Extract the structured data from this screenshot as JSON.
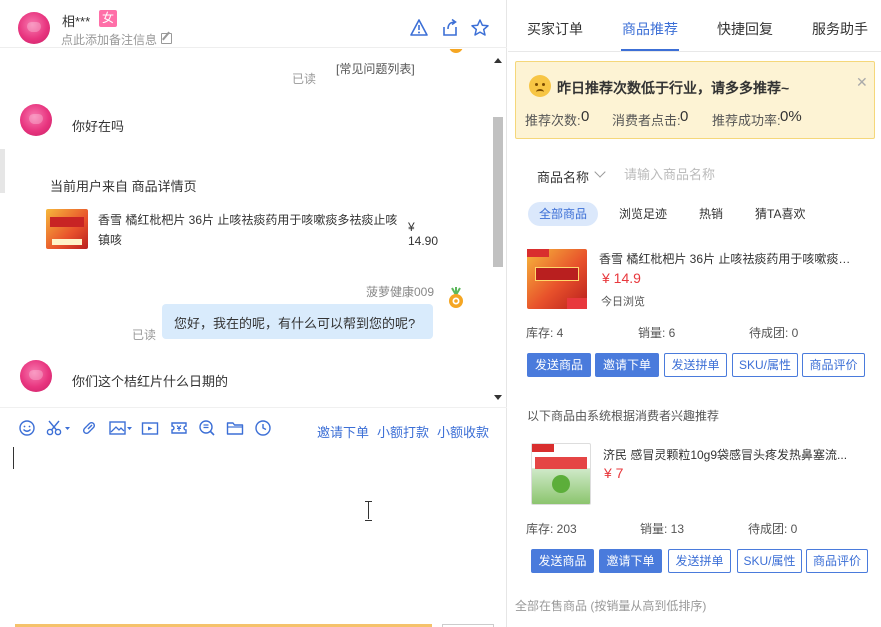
{
  "header": {
    "user_name": "相***",
    "gender": "女",
    "remark_placeholder": "点此添加备注信息"
  },
  "chat": {
    "faq_link": "[常见问题列表]",
    "read_label": "已读",
    "messages": [
      {
        "from": "customer",
        "text": "你好在吗"
      },
      {
        "from": "system",
        "text": "当前用户来自 商品详情页"
      },
      {
        "from": "agent",
        "text": "您好，我在的呢，有什么可以帮到您的呢?"
      },
      {
        "from": "customer",
        "text": "你们这个桔红片什么日期的"
      }
    ],
    "product_card": {
      "title": "香雪 橘红枇杷片 36片 止咳祛痰药用于咳嗽痰多祛痰止咳镇咳",
      "price": "¥ 14.90"
    },
    "agent_name": "菠萝健康009"
  },
  "toolbar": {
    "links": [
      "邀请下单",
      "小额打款",
      "小额收款"
    ]
  },
  "right": {
    "tabs": [
      "买家订单",
      "商品推荐",
      "快捷回复",
      "服务助手"
    ],
    "active_tab": 1,
    "notice": {
      "title": "昨日推荐次数低于行业，请多多推荐~",
      "stats": [
        {
          "label": "推荐次数:",
          "value": "0"
        },
        {
          "label": "消费者点击:",
          "value": "0"
        },
        {
          "label": "推荐成功率:",
          "value": "0%"
        }
      ]
    },
    "filter": {
      "label": "商品名称",
      "placeholder": "请输入商品名称"
    },
    "chips": [
      "全部商品",
      "浏览足迹",
      "热销",
      "猜TA喜欢"
    ],
    "products": [
      {
        "title": "香雪 橘红枇杷片 36片 止咳祛痰药用于咳嗽痰多...",
        "price": "¥ 14.9",
        "tag": "今日浏览",
        "stock": "库存: 4",
        "sales": "销量: 6",
        "pending": "待成团: 0"
      },
      {
        "title": "济民 感冒灵颗粒10g9袋感冒头疼发热鼻塞流...",
        "price": "¥ 7",
        "tag": "",
        "stock": "库存: 203",
        "sales": "销量: 13",
        "pending": "待成团: 0"
      }
    ],
    "buttons": [
      "发送商品",
      "邀请下单",
      "发送拼单",
      "SKU/属性",
      "商品评价"
    ],
    "section_title": "以下商品由系统根据消费者兴趣推荐",
    "footer_label": "全部在售商品 (按销量从高到低排序)"
  },
  "colors": {
    "accent": "#3c6fd6",
    "price": "#e8383d",
    "notice_bg": "#fdf3d4"
  }
}
